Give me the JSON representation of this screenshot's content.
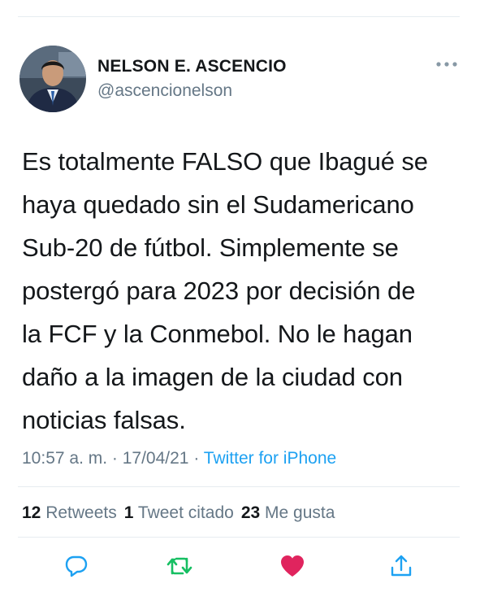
{
  "author": {
    "name": "NELSON E. ASCENCIO",
    "handle": "@ascencionelson",
    "avatar_icon": "profile-photo-avatar"
  },
  "tweet": {
    "text": "Es totalmente FALSO que Ibagué se haya quedado sin el Sudamericano Sub-20 de fútbol. Simplemente se postergó para 2023 por decisión de la FCF y la Conmebol. No le hagan daño a la imagen de la ciudad con noticias falsas.",
    "lines": [
      "Es totalmente FALSO que Ibagué se",
      "haya quedado sin el Sudamericano",
      "Sub-20 de fútbol. Simplemente se",
      "postergó para 2023 por decisión de",
      "la FCF y la Conmebol. No le hagan",
      "daño a la imagen de la ciudad con",
      "noticias falsas."
    ]
  },
  "meta": {
    "time": "10:57 a. m.",
    "separator": " · ",
    "date": "17/04/21",
    "source": "Twitter for iPhone"
  },
  "stats": {
    "retweets_count": "12",
    "retweets_label": "Retweets",
    "quotes_count": "1",
    "quotes_label": "Tweet citado",
    "likes_count": "23",
    "likes_label": "Me gusta"
  },
  "actions": {
    "reply_icon": "reply-icon",
    "retweet_icon": "retweet-icon",
    "like_icon": "heart-icon",
    "share_icon": "share-icon"
  },
  "colors": {
    "text": "#14171a",
    "secondary": "#657786",
    "link": "#1da1f2",
    "retweet": "#17bf63",
    "like": "#e0245e",
    "divider": "#e6ecf0"
  }
}
